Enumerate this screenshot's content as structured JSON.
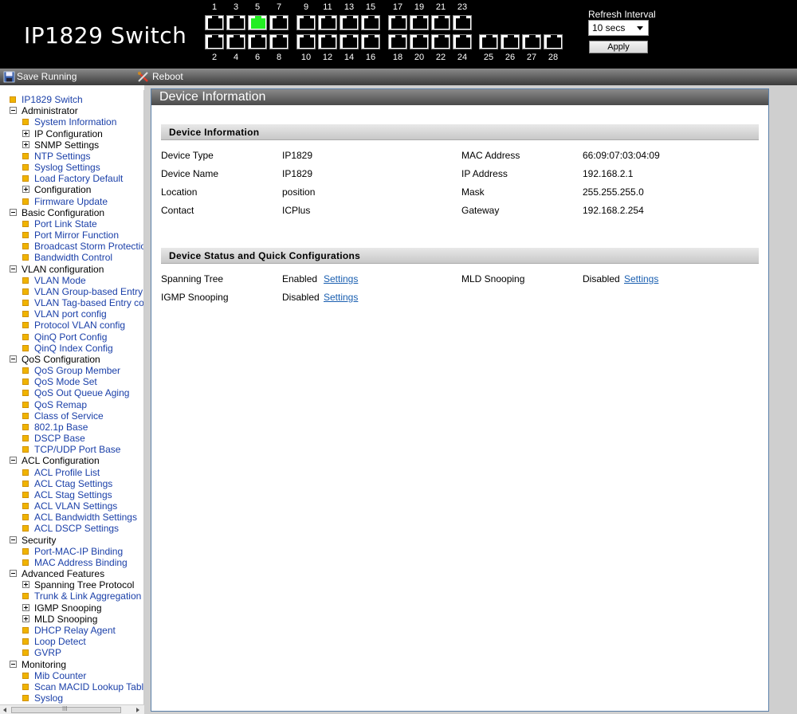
{
  "header": {
    "title": "IP1829 Switch",
    "top_ports": [
      "1",
      "3",
      "5",
      "7",
      "9",
      "11",
      "13",
      "15",
      "17",
      "19",
      "21",
      "23"
    ],
    "bottom_ports": [
      "2",
      "4",
      "6",
      "8",
      "10",
      "12",
      "14",
      "16",
      "18",
      "20",
      "22",
      "24",
      "25",
      "26",
      "27",
      "28"
    ],
    "active_port": "5",
    "refresh_label": "Refresh Interval",
    "refresh_value": "10 secs",
    "apply_label": "Apply"
  },
  "toolbar": {
    "save_label": "Save Running Configuration",
    "reboot_label": "Reboot System"
  },
  "sidebar": [
    {
      "label": "IP1829 Switch",
      "type": "page",
      "level": 0
    },
    {
      "label": "Administrator",
      "type": "minus",
      "level": 0
    },
    {
      "label": "System Information",
      "type": "page",
      "level": 1
    },
    {
      "label": "IP Configuration",
      "type": "plus",
      "level": 1
    },
    {
      "label": "SNMP Settings",
      "type": "plus",
      "level": 1
    },
    {
      "label": "NTP Settings",
      "type": "page",
      "level": 1
    },
    {
      "label": "Syslog Settings",
      "type": "page",
      "level": 1
    },
    {
      "label": "Load Factory Default",
      "type": "page",
      "level": 1
    },
    {
      "label": "Configuration",
      "type": "plus",
      "level": 1
    },
    {
      "label": "Firmware Update",
      "type": "page",
      "level": 1
    },
    {
      "label": "Basic Configuration",
      "type": "minus",
      "level": 0
    },
    {
      "label": "Port Link State",
      "type": "page",
      "level": 1
    },
    {
      "label": "Port Mirror Function",
      "type": "page",
      "level": 1
    },
    {
      "label": "Broadcast Storm Protection",
      "type": "page",
      "level": 1
    },
    {
      "label": "Bandwidth Control",
      "type": "page",
      "level": 1
    },
    {
      "label": "VLAN configuration",
      "type": "minus",
      "level": 0
    },
    {
      "label": "VLAN Mode",
      "type": "page",
      "level": 1
    },
    {
      "label": "VLAN Group-based Entry config",
      "type": "page",
      "level": 1
    },
    {
      "label": "VLAN Tag-based Entry config",
      "type": "page",
      "level": 1
    },
    {
      "label": "VLAN port config",
      "type": "page",
      "level": 1
    },
    {
      "label": "Protocol VLAN config",
      "type": "page",
      "level": 1
    },
    {
      "label": "QinQ Port Config",
      "type": "page",
      "level": 1
    },
    {
      "label": "QinQ Index Config",
      "type": "page",
      "level": 1
    },
    {
      "label": "QoS Configuration",
      "type": "minus",
      "level": 0
    },
    {
      "label": "QoS Group Member",
      "type": "page",
      "level": 1
    },
    {
      "label": "QoS Mode Set",
      "type": "page",
      "level": 1
    },
    {
      "label": "QoS Out Queue Aging",
      "type": "page",
      "level": 1
    },
    {
      "label": "QoS Remap",
      "type": "page",
      "level": 1
    },
    {
      "label": "Class of Service",
      "type": "page",
      "level": 1
    },
    {
      "label": "802.1p Base",
      "type": "page",
      "level": 1
    },
    {
      "label": "DSCP Base",
      "type": "page",
      "level": 1
    },
    {
      "label": "TCP/UDP Port Base",
      "type": "page",
      "level": 1
    },
    {
      "label": "ACL Configuration",
      "type": "minus",
      "level": 0
    },
    {
      "label": "ACL Profile List",
      "type": "page",
      "level": 1
    },
    {
      "label": "ACL Ctag Settings",
      "type": "page",
      "level": 1
    },
    {
      "label": "ACL Stag Settings",
      "type": "page",
      "level": 1
    },
    {
      "label": "ACL VLAN Settings",
      "type": "page",
      "level": 1
    },
    {
      "label": "ACL Bandwidth Settings",
      "type": "page",
      "level": 1
    },
    {
      "label": "ACL DSCP Settings",
      "type": "page",
      "level": 1
    },
    {
      "label": "Security",
      "type": "minus",
      "level": 0
    },
    {
      "label": "Port-MAC-IP Binding",
      "type": "page",
      "level": 1
    },
    {
      "label": "MAC Address Binding",
      "type": "page",
      "level": 1
    },
    {
      "label": "Advanced Features",
      "type": "minus",
      "level": 0
    },
    {
      "label": "Spanning Tree Protocol",
      "type": "plus",
      "level": 1
    },
    {
      "label": "Trunk & Link Aggregation",
      "type": "page",
      "level": 1
    },
    {
      "label": "IGMP Snooping",
      "type": "plus",
      "level": 1
    },
    {
      "label": "MLD Snooping",
      "type": "plus",
      "level": 1
    },
    {
      "label": "DHCP Relay Agent",
      "type": "page",
      "level": 1
    },
    {
      "label": "Loop Detect",
      "type": "page",
      "level": 1
    },
    {
      "label": "GVRP",
      "type": "page",
      "level": 1
    },
    {
      "label": "Monitoring",
      "type": "minus",
      "level": 0
    },
    {
      "label": "Mib Counter",
      "type": "page",
      "level": 1
    },
    {
      "label": "Scan MACID Lookup Table",
      "type": "page",
      "level": 1
    },
    {
      "label": "Syslog",
      "type": "page",
      "level": 1
    }
  ],
  "main": {
    "panel_title": "Device Information",
    "section1_title": "Device Information",
    "info": {
      "device_type_label": "Device Type",
      "device_type": "IP1829",
      "device_name_label": "Device Name",
      "device_name": "IP1829",
      "location_label": "Location",
      "location": "position",
      "contact_label": "Contact",
      "contact": "ICPlus",
      "mac_label": "MAC Address",
      "mac": "66:09:07:03:04:09",
      "ip_label": "IP Address",
      "ip": "192.168.2.1",
      "mask_label": "Mask",
      "mask": "255.255.255.0",
      "gateway_label": "Gateway",
      "gateway": "192.168.2.254"
    },
    "section2_title": "Device Status and Quick Configurations",
    "status": {
      "stp_label": "Spanning Tree",
      "stp_value": "Enabled",
      "igmp_label": "IGMP Snooping",
      "igmp_value": "Disabled",
      "mld_label": "MLD Snooping",
      "mld_value": "Disabled",
      "settings_link": "Settings"
    }
  },
  "scrollbar_grip": "III"
}
